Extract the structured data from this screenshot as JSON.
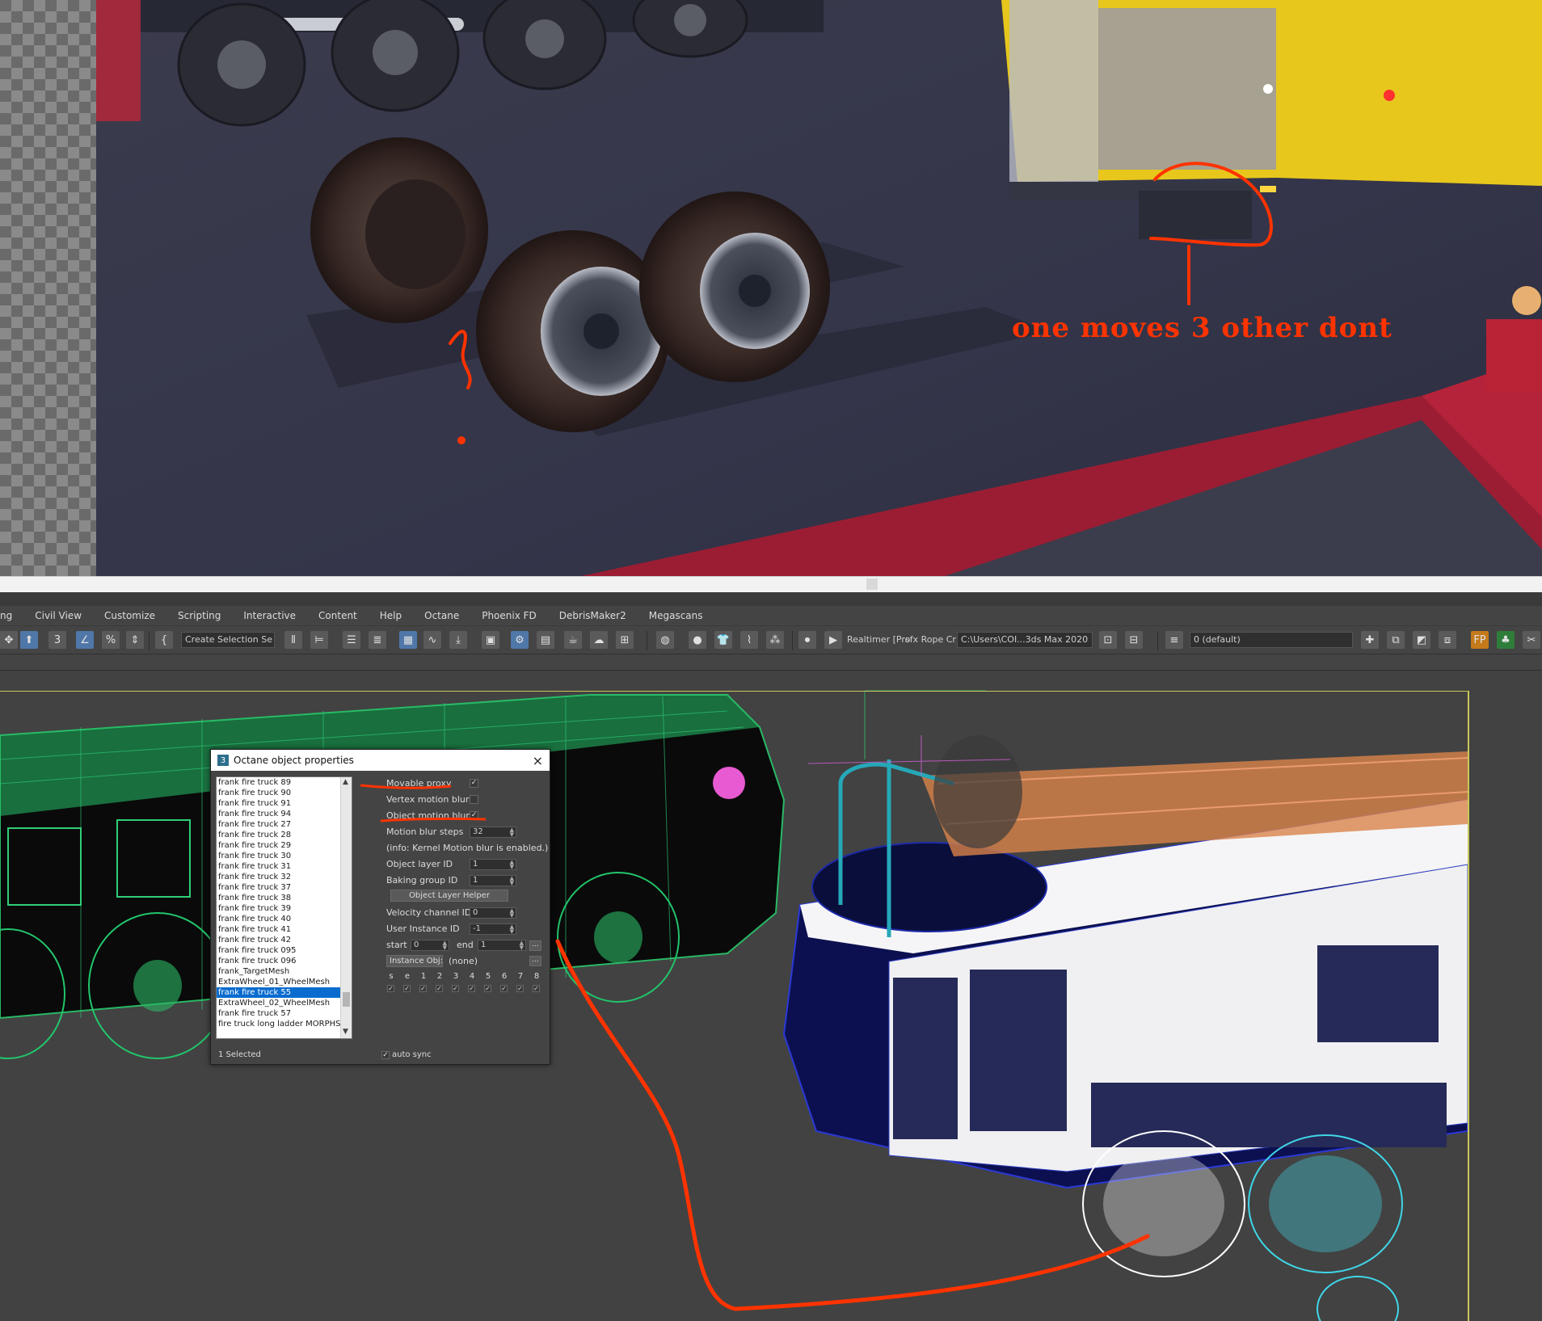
{
  "render": {
    "annotation": "one moves 3 other dont"
  },
  "menu": {
    "clipped_first": "ng",
    "items": [
      "Civil View",
      "Customize",
      "Scripting",
      "Interactive",
      "Content",
      "Help",
      "Octane",
      "Phoenix FD",
      "DebrisMaker2",
      "Megascans"
    ]
  },
  "toolbar": {
    "selection_set_placeholder": "Create Selection Se",
    "project_label": "Realtimer [Pro",
    "rope_label": "sfx Rope Cr",
    "path_field": "C:\\Users\\COI...3ds Max 2020",
    "layer_field": "0 (default)",
    "fp_label": "FP"
  },
  "dialog": {
    "title": "Octane object properties",
    "app_icon": "3",
    "close_icon": "×",
    "objects": [
      "frank fire truck 89",
      "frank fire truck 90",
      "frank fire truck 91",
      "frank fire truck 94",
      "frank fire truck 27",
      "frank fire truck 28",
      "frank fire truck 29",
      "frank fire truck 30",
      "frank fire truck 31",
      "frank fire truck 32",
      "frank fire truck 37",
      "frank fire truck 38",
      "frank fire truck 39",
      "frank fire truck 40",
      "frank fire truck 41",
      "frank fire truck 42",
      "frank fire truck 095",
      "frank fire truck 096",
      "frank_TargetMesh",
      "ExtraWheel_01_WheelMesh",
      "frank fire truck 55",
      "ExtraWheel_02_WheelMesh",
      "frank fire truck 57",
      "fire truck long ladder MORPHS"
    ],
    "selected_object": "frank fire truck 55",
    "props": {
      "movable_proxy": "Movable proxy",
      "vertex_motion_blur": "Vertex motion blur",
      "object_motion_blur": "Object motion blur",
      "motion_blur_steps": "Motion blur steps",
      "motion_blur_steps_value": "32",
      "info": "(info: Kernel Motion blur is enabled.)",
      "object_layer_id": "Object layer ID",
      "object_layer_id_value": "1",
      "baking_group_id": "Baking group ID",
      "baking_group_id_value": "1",
      "object_layer_helper": "Object Layer Helper",
      "velocity_channel_id": "Velocity channel ID",
      "velocity_channel_id_value": "0",
      "user_instance_id": "User Instance ID",
      "user_instance_id_value": "-1",
      "start_label": "start",
      "start_value": "0",
      "end_label": "end",
      "end_value": "1",
      "ellipsis": "...",
      "instance_obj": "Instance Obj:",
      "instance_value": "(none)",
      "bit_labels": [
        "s",
        "e",
        "1",
        "2",
        "3",
        "4",
        "5",
        "6",
        "7",
        "8"
      ]
    },
    "checks": {
      "movable_proxy": true,
      "vertex_motion_blur": false,
      "object_motion_blur": true
    },
    "status": {
      "selected": "1 Selected",
      "auto_sync": "auto sync"
    }
  }
}
